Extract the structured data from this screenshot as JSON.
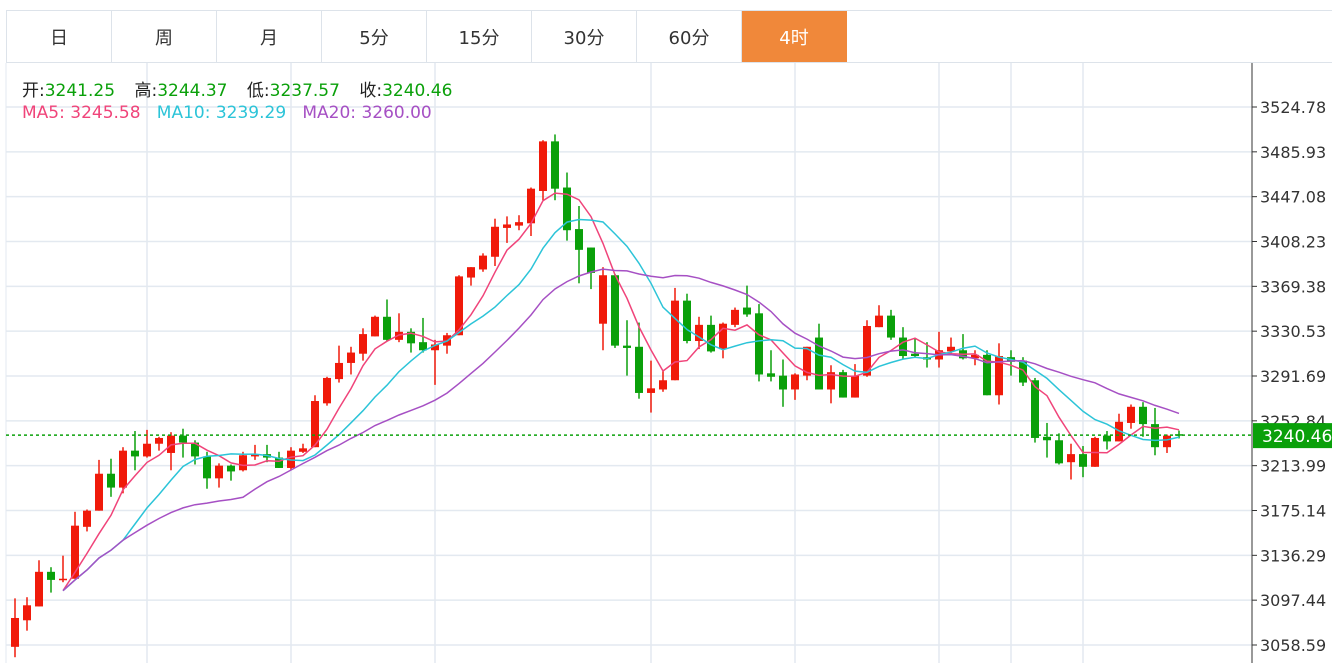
{
  "tabs": [
    {
      "label": "日",
      "active": false
    },
    {
      "label": "周",
      "active": false
    },
    {
      "label": "月",
      "active": false
    },
    {
      "label": "5分",
      "active": false
    },
    {
      "label": "15分",
      "active": false
    },
    {
      "label": "30分",
      "active": false
    },
    {
      "label": "60分",
      "active": false
    },
    {
      "label": "4时",
      "active": true
    }
  ],
  "ohlc_legend": {
    "open_label": "开:",
    "open": "3241.25",
    "high_label": "高:",
    "high": "3244.37",
    "low_label": "低:",
    "low": "3237.57",
    "close_label": "收:",
    "close": "3240.46"
  },
  "ma_legend": {
    "ma5_label": "MA5:",
    "ma5": "3245.58",
    "ma10_label": "MA10:",
    "ma10": "3239.29",
    "ma20_label": "MA20:",
    "ma20": "3260.00"
  },
  "colors": {
    "up": "#f01a0a",
    "down": "#0aa00a",
    "ma5": "#f0447a",
    "ma10": "#2cc4d8",
    "ma20": "#a650c4",
    "accent": "#f0883a"
  },
  "chart_data": {
    "type": "candlestick",
    "title": "",
    "ylim": [
      3058.59,
      3524.78
    ],
    "yticks": [
      "3524.78",
      "3485.93",
      "3447.08",
      "3408.23",
      "3369.38",
      "3330.53",
      "3291.69",
      "3252.84",
      "3213.99",
      "3175.14",
      "3136.29",
      "3097.44",
      "3058.59"
    ],
    "last_price": "3240.46",
    "grid": true,
    "candles": [
      [
        3057,
        3099,
        3048,
        3082
      ],
      [
        3080,
        3100,
        3071,
        3093
      ],
      [
        3092,
        3132,
        3092,
        3122
      ],
      [
        3122,
        3126,
        3104,
        3115
      ],
      [
        3115,
        3136,
        3113,
        3116
      ],
      [
        3116,
        3174,
        3116,
        3162
      ],
      [
        3161,
        3176,
        3157,
        3175
      ],
      [
        3175,
        3219,
        3175,
        3207
      ],
      [
        3207,
        3220,
        3187,
        3195
      ],
      [
        3195,
        3230,
        3190,
        3227
      ],
      [
        3227,
        3244,
        3210,
        3222
      ],
      [
        3222,
        3245,
        3221,
        3233
      ],
      [
        3233,
        3239,
        3227,
        3238
      ],
      [
        3225,
        3243,
        3210,
        3240
      ],
      [
        3240,
        3246,
        3221,
        3234
      ],
      [
        3234,
        3236,
        3215,
        3222
      ],
      [
        3222,
        3226,
        3194,
        3203
      ],
      [
        3203,
        3216,
        3195,
        3214
      ],
      [
        3214,
        3215,
        3201,
        3209
      ],
      [
        3210,
        3226,
        3209,
        3223
      ],
      [
        3222,
        3232,
        3219,
        3224
      ],
      [
        3224,
        3232,
        3217,
        3221
      ],
      [
        3221,
        3226,
        3212,
        3212
      ],
      [
        3212,
        3230,
        3210,
        3227
      ],
      [
        3226,
        3233,
        3225,
        3229
      ],
      [
        3230,
        3275,
        3230,
        3270
      ],
      [
        3268,
        3291,
        3266,
        3290
      ],
      [
        3289,
        3318,
        3286,
        3303
      ],
      [
        3303,
        3317,
        3293,
        3312
      ],
      [
        3311,
        3333,
        3305,
        3328
      ],
      [
        3326,
        3344,
        3326,
        3343
      ],
      [
        3343,
        3358,
        3322,
        3323
      ],
      [
        3323,
        3346,
        3321,
        3330
      ],
      [
        3330,
        3333,
        3312,
        3320
      ],
      [
        3321,
        3342,
        3312,
        3314
      ],
      [
        3314,
        3323,
        3284,
        3319
      ],
      [
        3318,
        3329,
        3311,
        3327
      ],
      [
        3327,
        3379,
        3327,
        3378
      ],
      [
        3377,
        3386,
        3370,
        3386
      ],
      [
        3384,
        3398,
        3382,
        3396
      ],
      [
        3395,
        3428,
        3387,
        3421
      ],
      [
        3420,
        3430,
        3407,
        3423
      ],
      [
        3422,
        3431,
        3418,
        3425
      ],
      [
        3424,
        3455,
        3413,
        3454
      ],
      [
        3452,
        3496,
        3444,
        3495
      ],
      [
        3495,
        3501,
        3444,
        3454
      ],
      [
        3455,
        3468,
        3409,
        3418
      ],
      [
        3419,
        3439,
        3372,
        3401
      ],
      [
        3403,
        3403,
        3367,
        3381
      ],
      [
        3337,
        3386,
        3314,
        3379
      ],
      [
        3379,
        3380,
        3316,
        3318
      ],
      [
        3318,
        3340,
        3292,
        3316
      ],
      [
        3317,
        3338,
        3272,
        3277
      ],
      [
        3277,
        3305,
        3260,
        3281
      ],
      [
        3280,
        3297,
        3278,
        3288
      ],
      [
        3288,
        3368,
        3288,
        3357
      ],
      [
        3357,
        3363,
        3320,
        3322
      ],
      [
        3322,
        3343,
        3315,
        3336
      ],
      [
        3336,
        3344,
        3312,
        3313
      ],
      [
        3315,
        3338,
        3307,
        3337
      ],
      [
        3336,
        3351,
        3334,
        3349
      ],
      [
        3351,
        3370,
        3343,
        3345
      ],
      [
        3346,
        3354,
        3287,
        3293
      ],
      [
        3294,
        3314,
        3287,
        3291
      ],
      [
        3292,
        3306,
        3265,
        3280
      ],
      [
        3280,
        3294,
        3271,
        3293
      ],
      [
        3292,
        3317,
        3288,
        3317
      ],
      [
        3325,
        3337,
        3280,
        3280
      ],
      [
        3280,
        3301,
        3268,
        3295
      ],
      [
        3295,
        3297,
        3273,
        3273
      ],
      [
        3273,
        3302,
        3273,
        3292
      ],
      [
        3292,
        3340,
        3291,
        3335
      ],
      [
        3334,
        3353,
        3334,
        3344
      ],
      [
        3344,
        3349,
        3323,
        3325
      ],
      [
        3325,
        3334,
        3306,
        3309
      ],
      [
        3311,
        3324,
        3308,
        3309
      ],
      [
        3308,
        3321,
        3299,
        3306
      ],
      [
        3306,
        3330,
        3299,
        3314
      ],
      [
        3313,
        3325,
        3310,
        3317
      ],
      [
        3314,
        3328,
        3306,
        3307
      ],
      [
        3307,
        3314,
        3301,
        3310
      ],
      [
        3310,
        3314,
        3275,
        3275
      ],
      [
        3275,
        3320,
        3267,
        3309
      ],
      [
        3308,
        3314,
        3292,
        3304
      ],
      [
        3305,
        3308,
        3283,
        3286
      ],
      [
        3288,
        3290,
        3234,
        3238
      ],
      [
        3239,
        3251,
        3221,
        3236
      ],
      [
        3236,
        3242,
        3215,
        3216
      ],
      [
        3217,
        3233,
        3202,
        3224
      ],
      [
        3224,
        3231,
        3204,
        3213
      ],
      [
        3213,
        3239,
        3213,
        3238
      ],
      [
        3240,
        3244,
        3228,
        3235
      ],
      [
        3235,
        3259,
        3235,
        3252
      ],
      [
        3251,
        3267,
        3246,
        3265
      ],
      [
        3265,
        3269,
        3239,
        3250
      ],
      [
        3250,
        3264,
        3223,
        3230
      ],
      [
        3230,
        3241,
        3225,
        3240
      ],
      [
        3241.25,
        3244.37,
        3237.57,
        3240.46
      ]
    ]
  }
}
